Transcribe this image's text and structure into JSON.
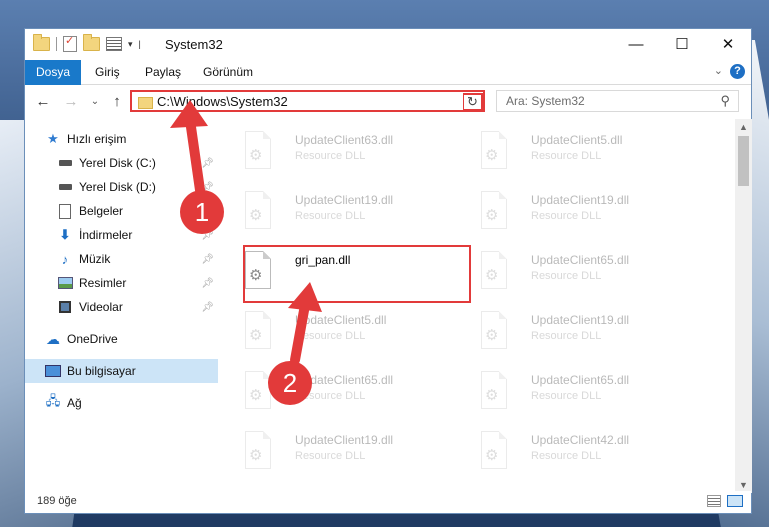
{
  "window": {
    "title": "System32"
  },
  "ribbon": {
    "tabs": [
      "Dosya",
      "Giriş",
      "Paylaş",
      "Görünüm"
    ],
    "help": "?"
  },
  "nav": {
    "address": "C:\\Windows\\System32",
    "search_placeholder": "Ara: System32"
  },
  "sidebar": {
    "items": [
      {
        "label": "Hızlı erişim",
        "icon": "star-icon"
      },
      {
        "label": "Yerel Disk (C:)",
        "icon": "drive-icon",
        "pinned": true
      },
      {
        "label": "Yerel Disk (D:)",
        "icon": "drive-icon",
        "pinned": true
      },
      {
        "label": "Belgeler",
        "icon": "document-icon",
        "pinned": true
      },
      {
        "label": "İndirmeler",
        "icon": "download-icon",
        "pinned": true
      },
      {
        "label": "Müzik",
        "icon": "music-icon",
        "pinned": true
      },
      {
        "label": "Resimler",
        "icon": "pictures-icon",
        "pinned": true
      },
      {
        "label": "Videolar",
        "icon": "video-icon",
        "pinned": true
      },
      {
        "label": "OneDrive",
        "icon": "cloud-icon"
      },
      {
        "label": "Bu bilgisayar",
        "icon": "computer-icon",
        "selected": true
      },
      {
        "label": "Ağ",
        "icon": "network-icon"
      }
    ]
  },
  "files": [
    {
      "name": "UpdateClient63.dll",
      "type": "Resource DLL"
    },
    {
      "name": "UpdateClient5.dll",
      "type": "Resource DLL"
    },
    {
      "name": "UpdateClient19.dll",
      "type": "Resource DLL"
    },
    {
      "name": "UpdateClient19.dll",
      "type": "Resource DLL"
    },
    {
      "name": "gri_pan.dll",
      "type": "",
      "highlighted": true
    },
    {
      "name": "UpdateClient65.dll",
      "type": "Resource DLL"
    },
    {
      "name": "UpdateClient5.dll",
      "type": "Resource DLL"
    },
    {
      "name": "UpdateClient19.dll",
      "type": "Resource DLL"
    },
    {
      "name": "UpdateClient65.dll",
      "type": "Resource DLL"
    },
    {
      "name": "UpdateClient65.dll",
      "type": "Resource DLL"
    },
    {
      "name": "UpdateClient19.dll",
      "type": "Resource DLL"
    },
    {
      "name": "UpdateClient42.dll",
      "type": "Resource DLL"
    }
  ],
  "status": {
    "count": "189 öğe"
  },
  "annotations": {
    "step1": "1",
    "step2": "2"
  },
  "colors": {
    "accent": "#1979ca",
    "highlight": "#e23a3a",
    "selection": "#cce4f7"
  }
}
